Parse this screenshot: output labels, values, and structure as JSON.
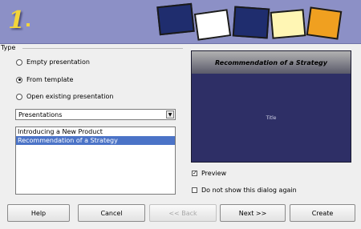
{
  "header": {
    "step_number": "1"
  },
  "group": {
    "label": "Type"
  },
  "radios": [
    {
      "label": "Empty presentation",
      "mnemonic": "E",
      "selected": false
    },
    {
      "label": "From template",
      "mnemonic": "F",
      "selected": true
    },
    {
      "label": "Open existing presentation",
      "mnemonic": "O",
      "selected": false
    }
  ],
  "category_select": {
    "value": "Presentations"
  },
  "templates": {
    "items": [
      "Introducing a New Product",
      "Recommendation of a Strategy"
    ],
    "selected_index": 1
  },
  "preview": {
    "title": "Recommendation of a Strategy",
    "subtitle": "Title"
  },
  "options": {
    "preview_label": "Preview",
    "preview_checked": true,
    "no_dialog_label": "Do not show this dialog again",
    "no_dialog_checked": false
  },
  "buttons": {
    "help": "Help",
    "cancel": "Cancel",
    "back": "<< Back",
    "next": "Next >>",
    "create": "Create"
  },
  "colors": {
    "banner": "#8c90c6",
    "selection": "#4b73c7",
    "preview_bg": "#2e2f66"
  }
}
